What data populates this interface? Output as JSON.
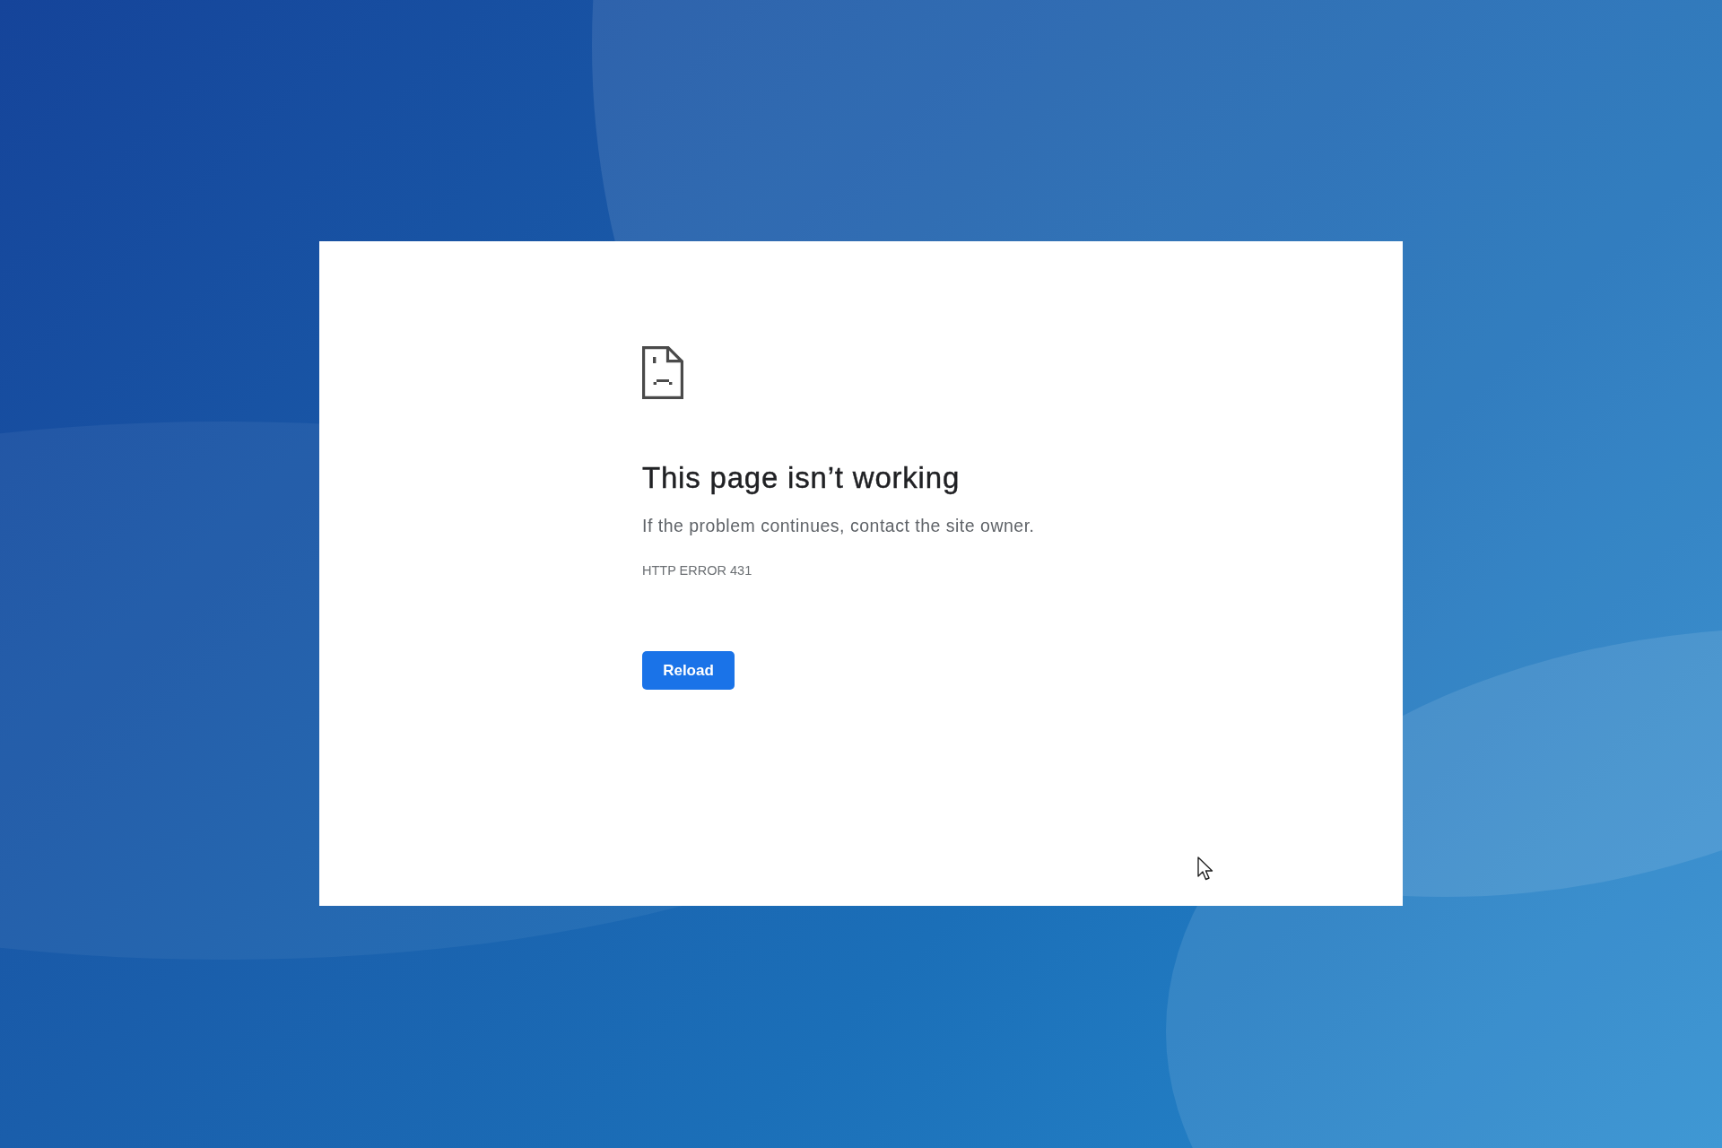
{
  "error_page": {
    "heading": "This page isn’t working",
    "message": "If the problem continues, contact the site owner.",
    "error_code": "HTTP ERROR 431",
    "reload_button": "Reload"
  }
}
